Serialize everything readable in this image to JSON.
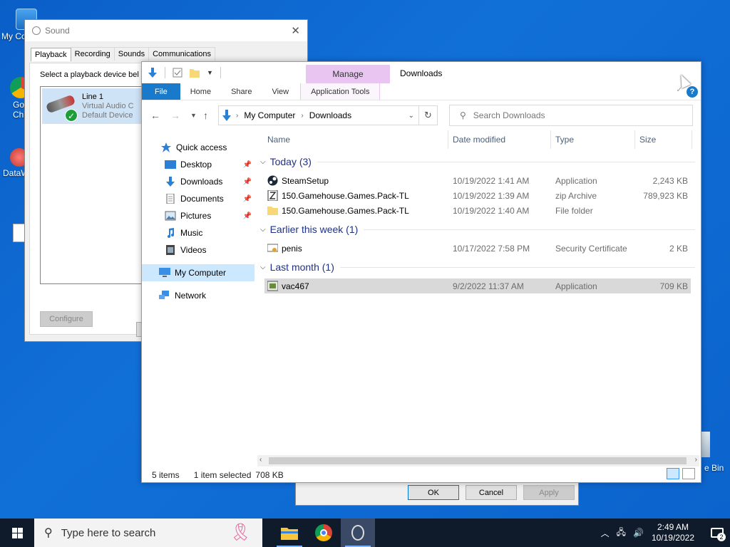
{
  "desktop": {
    "icons": [
      {
        "label": "My Co",
        "icon": "computer-icon"
      },
      {
        "label": "Go\nChr",
        "icon": "chrome-icon"
      },
      {
        "label": "DataW",
        "icon": "datawizard-icon"
      }
    ],
    "recycle_label": "e Bin"
  },
  "sound_dialog": {
    "title": "Sound",
    "tabs": [
      "Playback",
      "Recording",
      "Sounds",
      "Communications"
    ],
    "active_tab": "Playback",
    "instruction": "Select a playback device bel",
    "device": {
      "name": "Line 1",
      "desc": "Virtual Audio C",
      "status": "Default Device"
    },
    "configure_label": "Configure",
    "ok_label": "OK",
    "cancel_label": "Cancel",
    "apply_label": "Apply"
  },
  "explorer": {
    "title": "Downloads",
    "manage_label": "Manage",
    "ribbon_tabs": [
      "File",
      "Home",
      "Share",
      "View",
      "Application Tools"
    ],
    "address": [
      "My Computer",
      "Downloads"
    ],
    "search_placeholder": "Search Downloads",
    "nav": [
      {
        "label": "Quick access",
        "icon": "star-icon",
        "pinned": false,
        "indent": false
      },
      {
        "label": "Desktop",
        "icon": "desktop-icon",
        "pinned": true,
        "indent": true
      },
      {
        "label": "Downloads",
        "icon": "download-icon",
        "pinned": true,
        "indent": true
      },
      {
        "label": "Documents",
        "icon": "documents-icon",
        "pinned": true,
        "indent": true
      },
      {
        "label": "Pictures",
        "icon": "pictures-icon",
        "pinned": true,
        "indent": true
      },
      {
        "label": "Music",
        "icon": "music-icon",
        "pinned": false,
        "indent": true
      },
      {
        "label": "Videos",
        "icon": "videos-icon",
        "pinned": false,
        "indent": true
      },
      {
        "label": "My Computer",
        "icon": "computer-icon",
        "pinned": false,
        "indent": false,
        "selected": true
      },
      {
        "label": "Network",
        "icon": "network-icon",
        "pinned": false,
        "indent": false
      }
    ],
    "columns": [
      "Name",
      "Date modified",
      "Type",
      "Size"
    ],
    "groups": [
      {
        "label": "Today (3)",
        "files": [
          {
            "name": "SteamSetup",
            "date": "10/19/2022 1:41 AM",
            "type": "Application",
            "size": "2,243 KB",
            "icon": "steam-icon"
          },
          {
            "name": "150.Gamehouse.Games.Pack-TL",
            "date": "10/19/2022 1:39 AM",
            "type": "zip Archive",
            "size": "789,923 KB",
            "icon": "zip-icon"
          },
          {
            "name": "150.Gamehouse.Games.Pack-TL",
            "date": "10/19/2022 1:40 AM",
            "type": "File folder",
            "size": "",
            "icon": "folder-icon"
          }
        ]
      },
      {
        "label": "Earlier this week (1)",
        "files": [
          {
            "name": "penis",
            "date": "10/17/2022 7:58 PM",
            "type": "Security Certificate",
            "size": "2 KB",
            "icon": "certificate-icon"
          }
        ]
      },
      {
        "label": "Last month (1)",
        "files": [
          {
            "name": "vac467",
            "date": "9/2/2022 11:37 AM",
            "type": "Application",
            "size": "709 KB",
            "icon": "application-icon",
            "selected": true
          }
        ]
      }
    ],
    "status": {
      "items": "5 items",
      "selected": "1 item selected",
      "size": "708 KB"
    }
  },
  "taskbar": {
    "search_placeholder": "Type here to search",
    "time": "2:49 AM",
    "date": "10/19/2022",
    "notification_count": "2"
  }
}
